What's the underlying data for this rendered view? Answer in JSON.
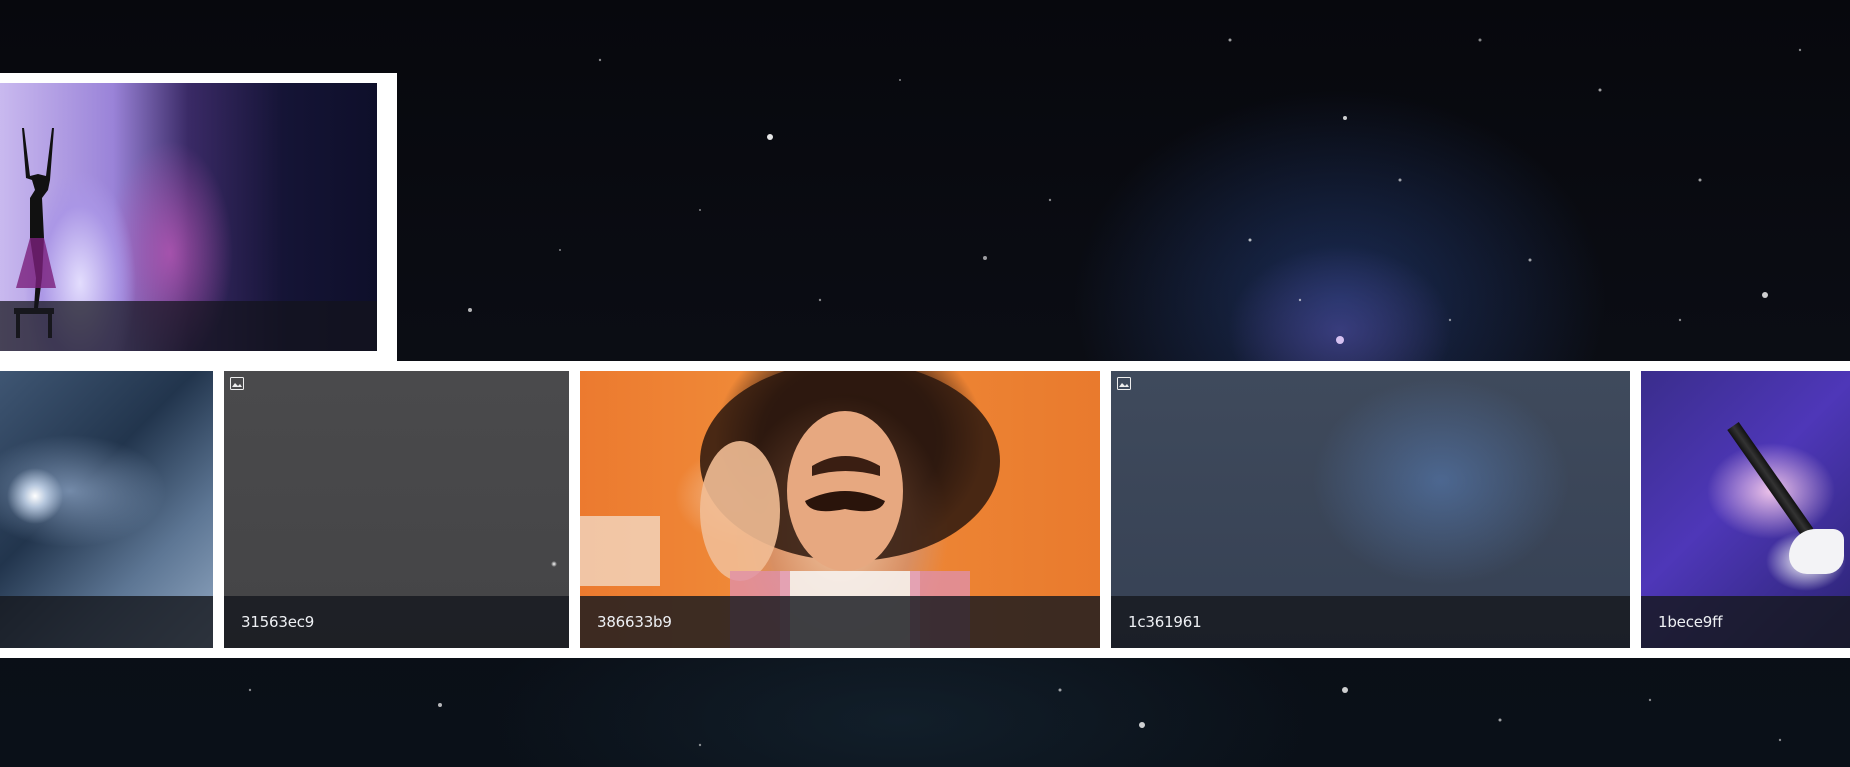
{
  "gallery": {
    "featured": {
      "caption": ""
    },
    "tiles": [
      {
        "id": "",
        "badge": false,
        "image": "galaxy-hand"
      },
      {
        "id": "31563ec9",
        "badge": true,
        "image": "night-sky"
      },
      {
        "id": "386633b9",
        "badge": false,
        "image": "man-gesturing"
      },
      {
        "id": "1c361961",
        "badge": true,
        "image": "milky-way"
      },
      {
        "id": "1bece9ff",
        "badge": false,
        "image": "magic-wand"
      }
    ]
  },
  "colors": {
    "caption_bg": "#16181e",
    "strip": "#ffffff",
    "background": "#07080d"
  },
  "icons": {
    "badge": "image-badge-icon"
  }
}
